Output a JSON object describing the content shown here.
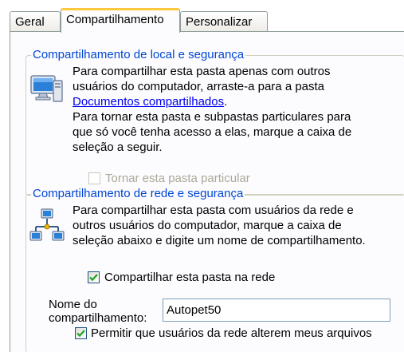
{
  "tabs": [
    {
      "label": "Geral",
      "active": false
    },
    {
      "label": "Compartilhamento",
      "active": true
    },
    {
      "label": "Personalizar",
      "active": false
    }
  ],
  "local_group": {
    "title": "Compartilhamento de local e segurança",
    "icon": "computer-icon",
    "paragraph1_lines": [
      "Para compartilhar esta pasta apenas com outros",
      "usuários do computador, arraste-a para a pasta"
    ],
    "link": "Documentos compartilhados",
    "link_suffix": ".",
    "paragraph2_lines": [
      "Para tornar esta pasta e subpastas particulares para",
      "que só você tenha acesso a elas, marque a caixa de",
      "seleção a seguir."
    ],
    "private_checkbox": {
      "label": "Tornar esta pasta particular",
      "checked": false,
      "disabled": true
    }
  },
  "network_group": {
    "title": "Compartilhamento de rede e segurança",
    "icon": "network-icon",
    "paragraph_lines": [
      "Para compartilhar esta pasta com usuários da rede e",
      "outros usuários do computador, marque a caixa de",
      "seleção abaixo e digite um nome de compartilhamento."
    ],
    "share_checkbox": {
      "label": "Compartilhar esta pasta na rede",
      "checked": true
    },
    "share_name_label_lines": [
      "Nome do",
      "compartilhamento:"
    ],
    "share_name_value": "Autopet50",
    "allow_edit_checkbox": {
      "label": "Permitir que usuários da rede alterem meus arquivos",
      "checked": true
    }
  },
  "colors": {
    "group_title": "#0046d5",
    "tab_highlight": "#ffc83c",
    "checkmark": "#21a121"
  }
}
